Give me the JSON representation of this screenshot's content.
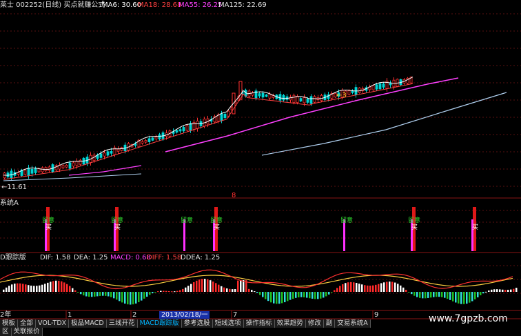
{
  "header": {
    "stock": "莱士 002252(日线) 买点就赚公式",
    "ma6": "MA6: 30.60",
    "ma18": "MA18: 28.68",
    "ma55": "MA55: 26.25",
    "ma125": "MA125: 22.69"
  },
  "price_panel": {
    "low_label": "←11.61",
    "tag_3": "←3",
    "center_mark": "8"
  },
  "signal_panel": {
    "title": "系统A",
    "watch_label": "留意",
    "buy_label": "买"
  },
  "macd_panel": {
    "title": "D跟踪版",
    "dif": "DIF: 1.58",
    "dea": "DEA: 1.25",
    "macd": "MACD: 0.68",
    "diff": "DIFF: 1.58",
    "ddea": "DDEA: 1.25"
  },
  "time_axis": {
    "year": "2年",
    "marks": [
      "1",
      "2",
      "7",
      "9"
    ],
    "current_date": "2013/02/18/一"
  },
  "tabs_row1": [
    "模板",
    "全部",
    "VOL-TDX",
    "极品MACD",
    "三线开花",
    "MACD跟踪版",
    "参考选股",
    "短线选项",
    "操作指标",
    "效果趋势",
    "修改",
    "副",
    "交易系统A"
  ],
  "active_tab": "MACD跟踪版",
  "tabs_row2": [
    "区",
    "关联报价"
  ],
  "watermark": "www.7gpzb.com",
  "colors": {
    "up": "#ff3030",
    "down": "#00d4d4",
    "ma6": "#ffffff",
    "ma18": "#ff4040",
    "ma55": "#ff40ff",
    "ma125": "#b0d0f0",
    "dash": "#5a1010",
    "accent": "#00b4ff"
  }
}
